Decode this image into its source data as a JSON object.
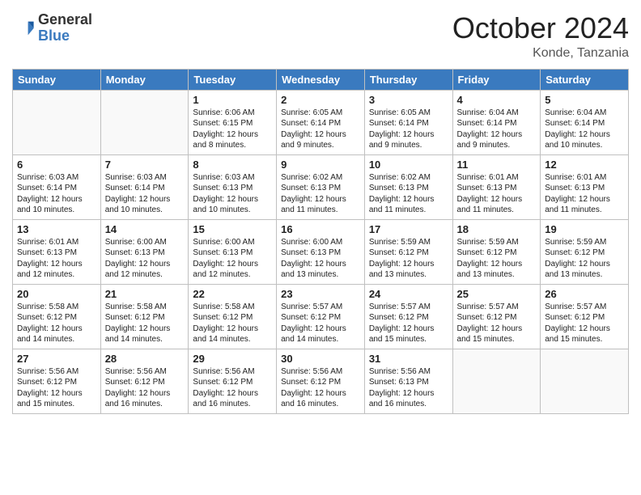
{
  "logo": {
    "general": "General",
    "blue": "Blue"
  },
  "header": {
    "month": "October 2024",
    "location": "Konde, Tanzania"
  },
  "weekdays": [
    "Sunday",
    "Monday",
    "Tuesday",
    "Wednesday",
    "Thursday",
    "Friday",
    "Saturday"
  ],
  "weeks": [
    [
      null,
      null,
      {
        "day": 1,
        "sunrise": "6:06 AM",
        "sunset": "6:15 PM",
        "daylight": "12 hours and 8 minutes."
      },
      {
        "day": 2,
        "sunrise": "6:05 AM",
        "sunset": "6:14 PM",
        "daylight": "12 hours and 9 minutes."
      },
      {
        "day": 3,
        "sunrise": "6:05 AM",
        "sunset": "6:14 PM",
        "daylight": "12 hours and 9 minutes."
      },
      {
        "day": 4,
        "sunrise": "6:04 AM",
        "sunset": "6:14 PM",
        "daylight": "12 hours and 9 minutes."
      },
      {
        "day": 5,
        "sunrise": "6:04 AM",
        "sunset": "6:14 PM",
        "daylight": "12 hours and 10 minutes."
      }
    ],
    [
      {
        "day": 6,
        "sunrise": "6:03 AM",
        "sunset": "6:14 PM",
        "daylight": "12 hours and 10 minutes."
      },
      {
        "day": 7,
        "sunrise": "6:03 AM",
        "sunset": "6:14 PM",
        "daylight": "12 hours and 10 minutes."
      },
      {
        "day": 8,
        "sunrise": "6:03 AM",
        "sunset": "6:13 PM",
        "daylight": "12 hours and 10 minutes."
      },
      {
        "day": 9,
        "sunrise": "6:02 AM",
        "sunset": "6:13 PM",
        "daylight": "12 hours and 11 minutes."
      },
      {
        "day": 10,
        "sunrise": "6:02 AM",
        "sunset": "6:13 PM",
        "daylight": "12 hours and 11 minutes."
      },
      {
        "day": 11,
        "sunrise": "6:01 AM",
        "sunset": "6:13 PM",
        "daylight": "12 hours and 11 minutes."
      },
      {
        "day": 12,
        "sunrise": "6:01 AM",
        "sunset": "6:13 PM",
        "daylight": "12 hours and 11 minutes."
      }
    ],
    [
      {
        "day": 13,
        "sunrise": "6:01 AM",
        "sunset": "6:13 PM",
        "daylight": "12 hours and 12 minutes."
      },
      {
        "day": 14,
        "sunrise": "6:00 AM",
        "sunset": "6:13 PM",
        "daylight": "12 hours and 12 minutes."
      },
      {
        "day": 15,
        "sunrise": "6:00 AM",
        "sunset": "6:13 PM",
        "daylight": "12 hours and 12 minutes."
      },
      {
        "day": 16,
        "sunrise": "6:00 AM",
        "sunset": "6:13 PM",
        "daylight": "12 hours and 13 minutes."
      },
      {
        "day": 17,
        "sunrise": "5:59 AM",
        "sunset": "6:12 PM",
        "daylight": "12 hours and 13 minutes."
      },
      {
        "day": 18,
        "sunrise": "5:59 AM",
        "sunset": "6:12 PM",
        "daylight": "12 hours and 13 minutes."
      },
      {
        "day": 19,
        "sunrise": "5:59 AM",
        "sunset": "6:12 PM",
        "daylight": "12 hours and 13 minutes."
      }
    ],
    [
      {
        "day": 20,
        "sunrise": "5:58 AM",
        "sunset": "6:12 PM",
        "daylight": "12 hours and 14 minutes."
      },
      {
        "day": 21,
        "sunrise": "5:58 AM",
        "sunset": "6:12 PM",
        "daylight": "12 hours and 14 minutes."
      },
      {
        "day": 22,
        "sunrise": "5:58 AM",
        "sunset": "6:12 PM",
        "daylight": "12 hours and 14 minutes."
      },
      {
        "day": 23,
        "sunrise": "5:57 AM",
        "sunset": "6:12 PM",
        "daylight": "12 hours and 14 minutes."
      },
      {
        "day": 24,
        "sunrise": "5:57 AM",
        "sunset": "6:12 PM",
        "daylight": "12 hours and 15 minutes."
      },
      {
        "day": 25,
        "sunrise": "5:57 AM",
        "sunset": "6:12 PM",
        "daylight": "12 hours and 15 minutes."
      },
      {
        "day": 26,
        "sunrise": "5:57 AM",
        "sunset": "6:12 PM",
        "daylight": "12 hours and 15 minutes."
      }
    ],
    [
      {
        "day": 27,
        "sunrise": "5:56 AM",
        "sunset": "6:12 PM",
        "daylight": "12 hours and 15 minutes."
      },
      {
        "day": 28,
        "sunrise": "5:56 AM",
        "sunset": "6:12 PM",
        "daylight": "12 hours and 16 minutes."
      },
      {
        "day": 29,
        "sunrise": "5:56 AM",
        "sunset": "6:12 PM",
        "daylight": "12 hours and 16 minutes."
      },
      {
        "day": 30,
        "sunrise": "5:56 AM",
        "sunset": "6:12 PM",
        "daylight": "12 hours and 16 minutes."
      },
      {
        "day": 31,
        "sunrise": "5:56 AM",
        "sunset": "6:13 PM",
        "daylight": "12 hours and 16 minutes."
      },
      null,
      null
    ]
  ]
}
